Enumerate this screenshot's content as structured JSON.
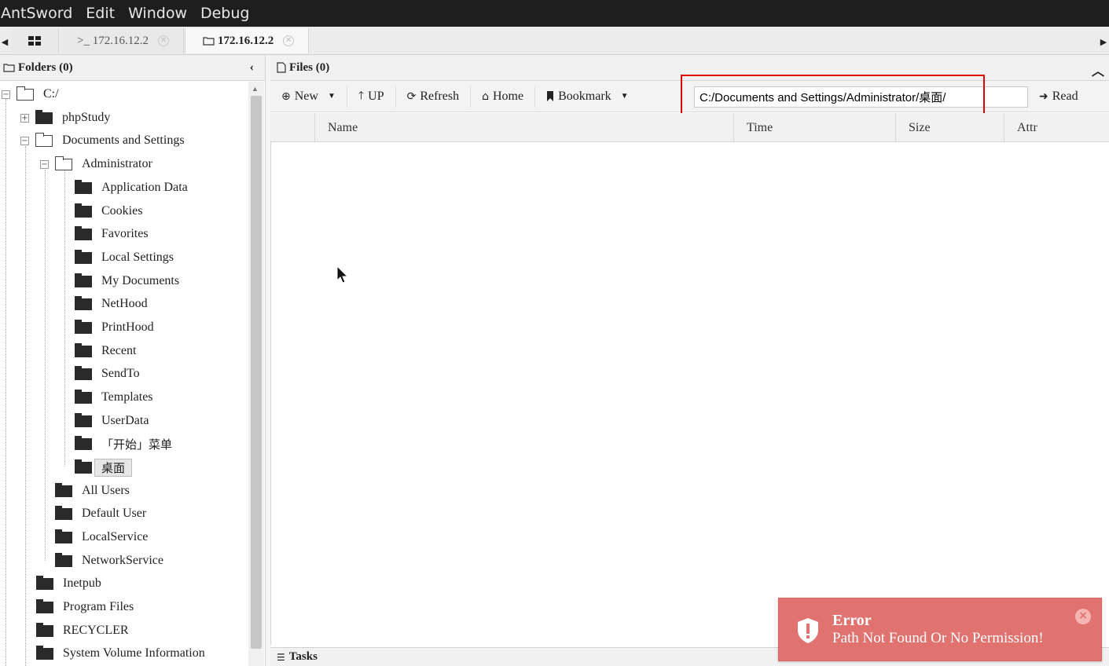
{
  "menubar": {
    "items": [
      "AntSword",
      "Edit",
      "Window",
      "Debug"
    ]
  },
  "tabs": {
    "home_icon": "grid-icon",
    "tab1_label": ">_ 172.16.12.2",
    "tab2_label": "172.16.12.2"
  },
  "folders": {
    "title": "Folders (0)",
    "root": "C:/",
    "tree": [
      {
        "label": "phpStudy"
      },
      {
        "label": "Documents and Settings"
      },
      {
        "label": "Administrator"
      },
      {
        "label": "Application Data"
      },
      {
        "label": "Cookies"
      },
      {
        "label": "Favorites"
      },
      {
        "label": "Local Settings"
      },
      {
        "label": "My Documents"
      },
      {
        "label": "NetHood"
      },
      {
        "label": "PrintHood"
      },
      {
        "label": "Recent"
      },
      {
        "label": "SendTo"
      },
      {
        "label": "Templates"
      },
      {
        "label": "UserData"
      },
      {
        "label": "「开始」菜单"
      },
      {
        "label": "桌面"
      },
      {
        "label": "All Users"
      },
      {
        "label": "Default User"
      },
      {
        "label": "LocalService"
      },
      {
        "label": "NetworkService"
      },
      {
        "label": "Inetpub"
      },
      {
        "label": "Program Files"
      },
      {
        "label": "RECYCLER"
      },
      {
        "label": "System Volume Information"
      }
    ]
  },
  "files": {
    "title": "Files (0)",
    "toolbar": {
      "new_label": "New",
      "up_label": "UP",
      "refresh_label": "Refresh",
      "home_label": "Home",
      "bookmark_label": "Bookmark",
      "path_value": "C:/Documents and Settings/Administrator/桌面/",
      "read_label": "Read"
    },
    "columns": [
      "Name",
      "Time",
      "Size",
      "Attr"
    ]
  },
  "tasks": {
    "label": "Tasks"
  },
  "toast": {
    "title": "Error",
    "message": "Path Not Found Or No Permission!",
    "color": "#e0736f"
  },
  "colors": {
    "highlight": "#e00000",
    "menubar_bg": "#1e1e1e"
  }
}
